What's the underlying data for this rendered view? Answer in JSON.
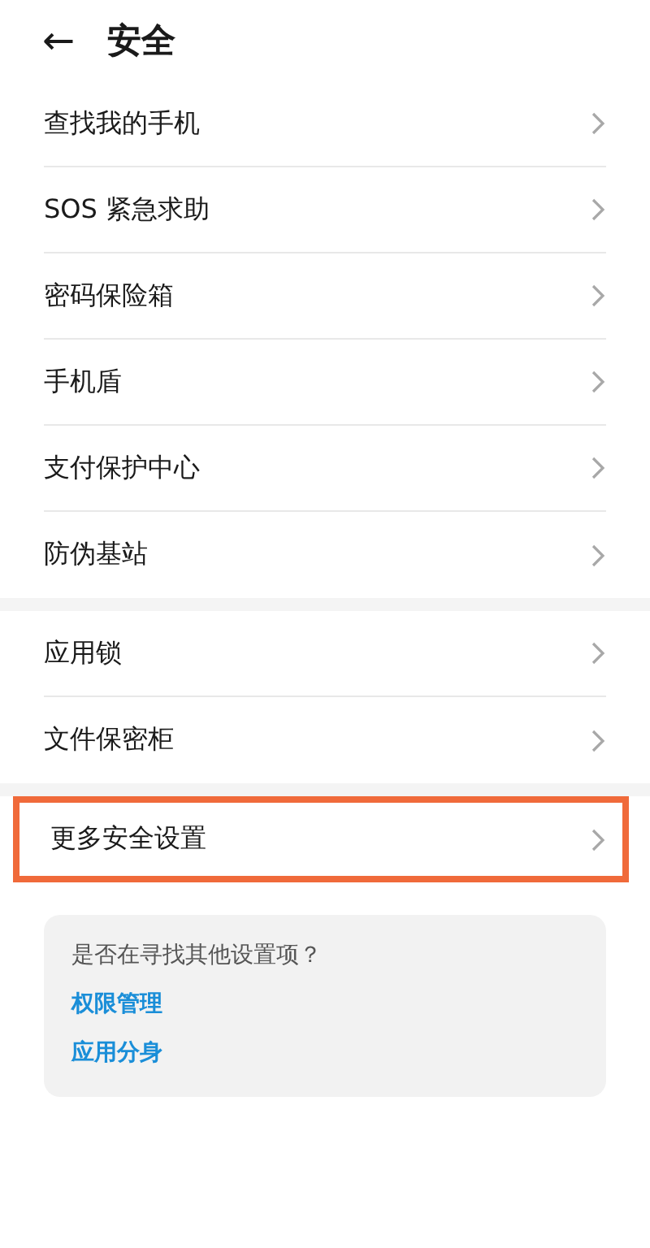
{
  "header": {
    "back": "←",
    "title": "安全"
  },
  "sections": [
    {
      "items": [
        {
          "label": "查找我的手机",
          "highlighted": false
        },
        {
          "label": "SOS 紧急求助",
          "highlighted": false
        },
        {
          "label": "密码保险箱",
          "highlighted": false
        },
        {
          "label": "手机盾",
          "highlighted": false
        },
        {
          "label": "支付保护中心",
          "highlighted": false
        },
        {
          "label": "防伪基站",
          "highlighted": false
        }
      ]
    },
    {
      "items": [
        {
          "label": "应用锁",
          "highlighted": false
        },
        {
          "label": "文件保密柜",
          "highlighted": false
        }
      ]
    },
    {
      "items": [
        {
          "label": "更多安全设置",
          "highlighted": true
        }
      ]
    }
  ],
  "suggestions": {
    "question": "是否在寻找其他设置项？",
    "links": [
      "权限管理",
      "应用分身"
    ]
  }
}
